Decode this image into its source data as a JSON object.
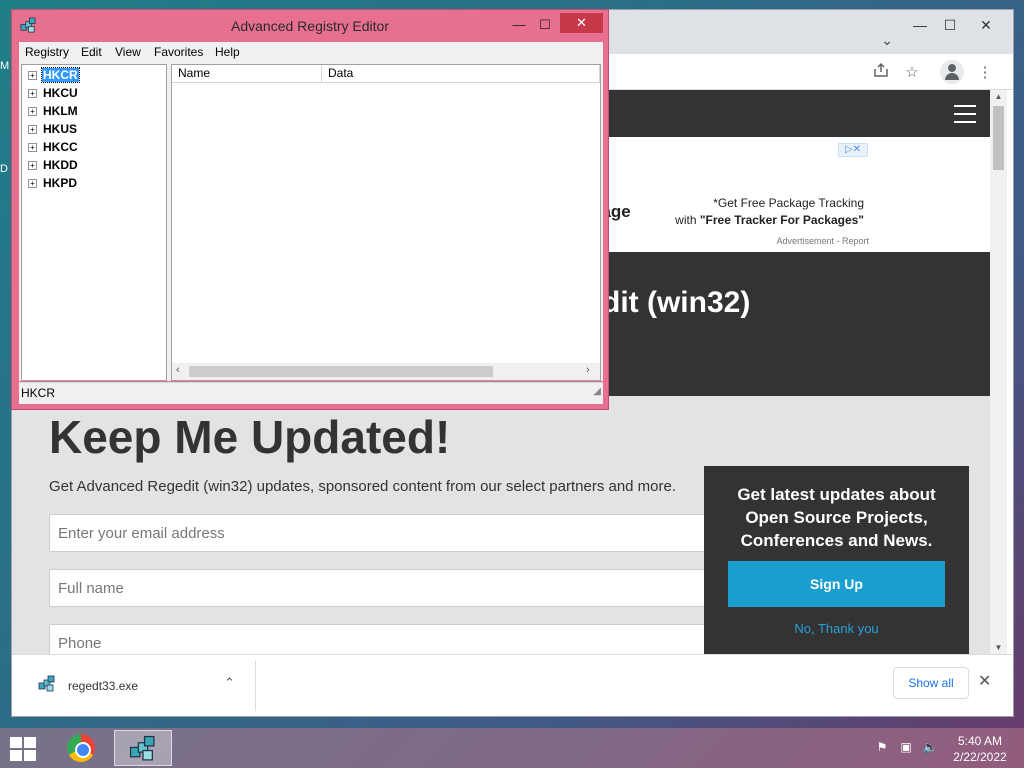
{
  "desktop": {
    "letter_1": "M",
    "letter_2": "D"
  },
  "browser": {
    "window_controls": {
      "minimize": "—",
      "maximize": "☐",
      "close": "✕"
    },
    "tab_dropdown": "⌄",
    "toolbar_icons": [
      "share-icon",
      "star-icon",
      "profile-icon",
      "menu-icon"
    ],
    "page": {
      "ad": {
        "badge": "▷✕",
        "left_fragment": "kage",
        "line1": "*Get Free Package Tracking",
        "line2_prefix": "with ",
        "line2_bold": "\"Free Tracker For Packages\"",
        "note": "Advertisement - Report"
      },
      "hero_title": "dit (win32)",
      "keep_title": "Keep Me Updated!",
      "keep_subtitle": "Get Advanced Regedit (win32) updates, sponsored content from our select partners and more.",
      "email_placeholder": "Enter your email address",
      "name_placeholder": "Full name",
      "phone_placeholder": "Phone",
      "signup_box": {
        "text": "Get latest updates about Open Source Projects, Conferences and News.",
        "button": "Sign Up",
        "decline": "No, Thank you"
      }
    },
    "download_bar": {
      "file_name": "regedt33.exe",
      "caret": "⌃",
      "show_all": "Show all",
      "close": "✕"
    }
  },
  "registry_editor": {
    "title": "Advanced Registry Editor",
    "window_controls": {
      "minimize": "—",
      "maximize": "☐",
      "close": "✕"
    },
    "menu": [
      "Registry",
      "Edit",
      "View",
      "Favorites",
      "Help"
    ],
    "tree": [
      {
        "label": "HKCR",
        "selected": true
      },
      {
        "label": "HKCU",
        "selected": false
      },
      {
        "label": "HKLM",
        "selected": false
      },
      {
        "label": "HKUS",
        "selected": false
      },
      {
        "label": "HKCC",
        "selected": false
      },
      {
        "label": "HKDD",
        "selected": false
      },
      {
        "label": "HKPD",
        "selected": false
      }
    ],
    "columns": [
      "Name",
      "Data"
    ],
    "status": "HKCR"
  },
  "taskbar": {
    "time": "5:40 AM",
    "date": "2/22/2022"
  }
}
